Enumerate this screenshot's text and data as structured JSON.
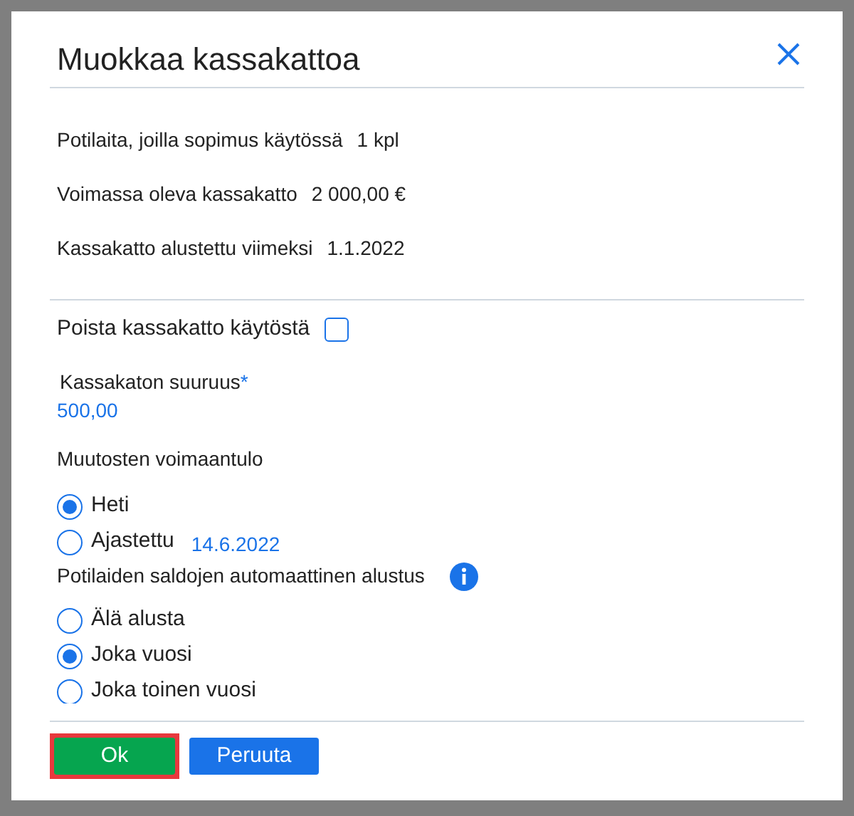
{
  "dialog": {
    "title": "Muokkaa kassakattoa"
  },
  "info_rows": [
    {
      "label": "Potilaita, joilla sopimus käytössä",
      "value": "1 kpl"
    },
    {
      "label": "Voimassa oleva kassakatto",
      "value": "2 000,00 €"
    },
    {
      "label": "Kassakatto alustettu viimeksi",
      "value": "1.1.2022"
    }
  ],
  "disable_option": {
    "label": "Poista kassakatto käytöstä",
    "checked": false
  },
  "amount_field": {
    "label": "Kassakaton suuruus",
    "required_mark": "*",
    "value": "500,00"
  },
  "effective": {
    "label": "Muutosten voimaantulo",
    "options": [
      {
        "label": "Heti",
        "selected": true
      },
      {
        "label": "Ajastettu",
        "selected": false,
        "date": "14.6.2022"
      }
    ]
  },
  "reset": {
    "label": "Potilaiden saldojen automaattinen alustus",
    "options": [
      {
        "label": "Älä alusta",
        "selected": false
      },
      {
        "label": "Joka vuosi",
        "selected": true
      },
      {
        "label": "Joka toinen vuosi",
        "selected": false
      }
    ]
  },
  "buttons": [
    {
      "label": "Ok",
      "kind": "primary",
      "highlighted": true
    },
    {
      "label": "Peruuta",
      "kind": "secondary",
      "highlighted": false
    }
  ]
}
